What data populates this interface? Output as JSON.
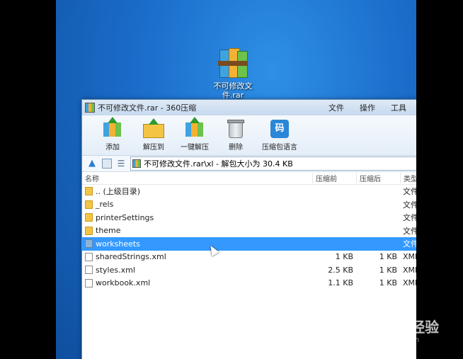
{
  "desktop": {
    "icon_label": "不可修改文件.rar"
  },
  "window": {
    "title": "不可修改文件.rar - 360压缩",
    "menu": [
      "文件",
      "操作",
      "工具"
    ]
  },
  "toolbar": {
    "add": "添加",
    "extract_to": "解压到",
    "one_click_extract": "一键解压",
    "delete": "删除",
    "compress_code": "压缩包语言"
  },
  "address": {
    "path": "不可修改文件.rar\\xl - 解包大小为 30.4 KB"
  },
  "columns": {
    "name": "名称",
    "packed": "压缩前",
    "original": "压缩后",
    "type": "类型"
  },
  "files": [
    {
      "name": ".. (上级目录)",
      "packed": "",
      "original": "",
      "type": "文件",
      "icon": "folder-icon",
      "selected": false
    },
    {
      "name": "_rels",
      "packed": "",
      "original": "",
      "type": "文件",
      "icon": "folder-icon",
      "selected": false
    },
    {
      "name": "printerSettings",
      "packed": "",
      "original": "",
      "type": "文件",
      "icon": "folder-icon",
      "selected": false
    },
    {
      "name": "theme",
      "packed": "",
      "original": "",
      "type": "文件",
      "icon": "folder-icon",
      "selected": false
    },
    {
      "name": "worksheets",
      "packed": "",
      "original": "",
      "type": "文件",
      "icon": "folder-icon",
      "selected": true
    },
    {
      "name": "sharedStrings.xml",
      "packed": "1 KB",
      "original": "1 KB",
      "type": "XML",
      "icon": "file-icon",
      "selected": false
    },
    {
      "name": "styles.xml",
      "packed": "2.5 KB",
      "original": "1 KB",
      "type": "XML",
      "icon": "file-icon",
      "selected": false
    },
    {
      "name": "workbook.xml",
      "packed": "1.1 KB",
      "original": "1 KB",
      "type": "XML",
      "icon": "file-icon",
      "selected": false
    }
  ],
  "watermark": {
    "brand": "Bai du 经验",
    "url": "jingyan.baidu.com"
  }
}
